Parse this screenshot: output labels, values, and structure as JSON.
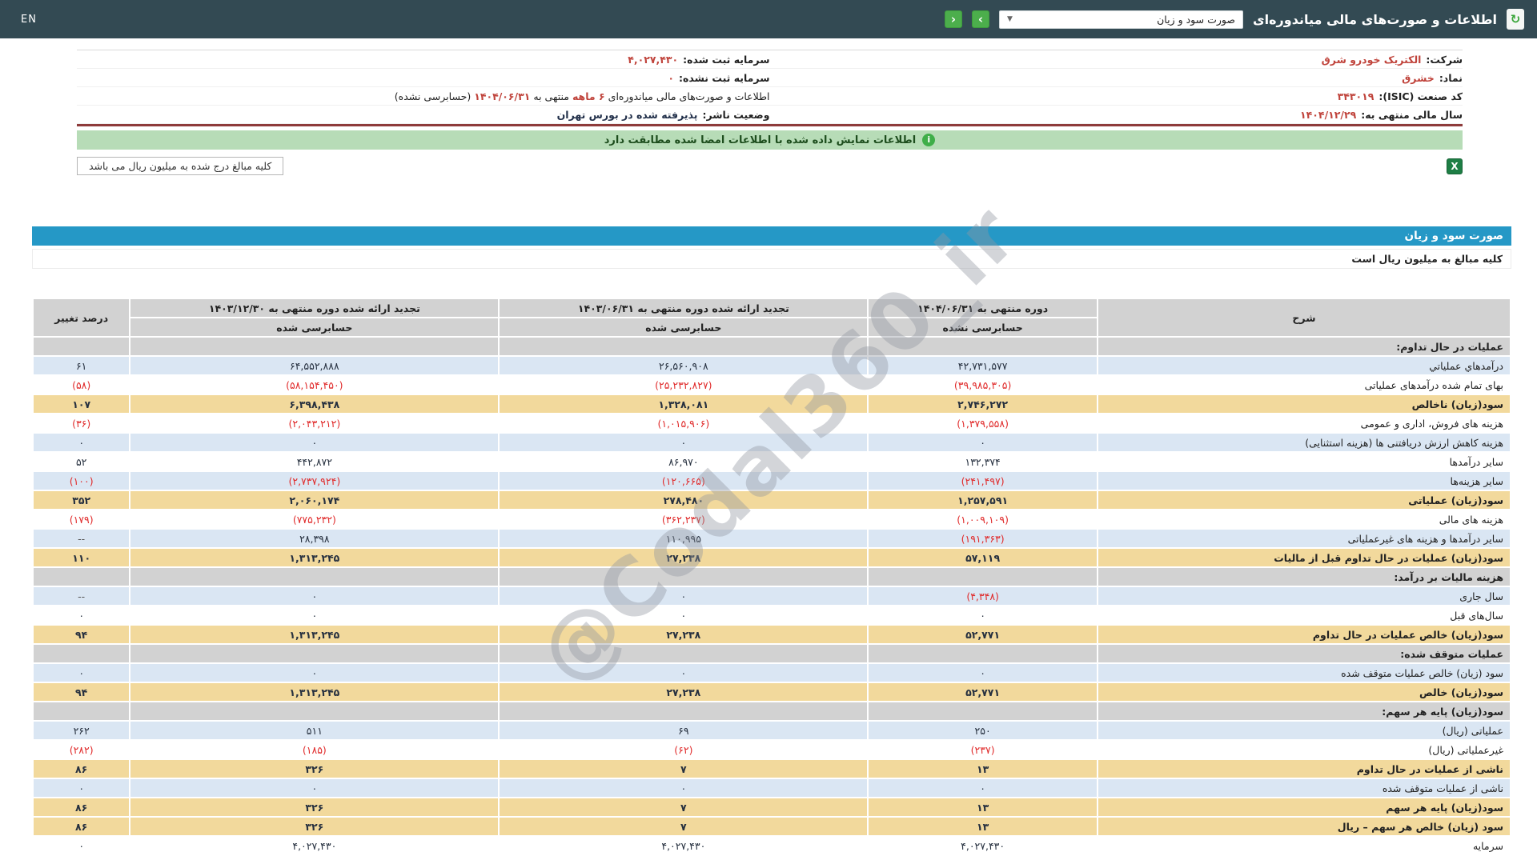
{
  "topbar": {
    "title": "اطلاعات و صورت‌های مالی میاندوره‌ای",
    "report_select_value": "صورت سود و زیان",
    "caret": "▼",
    "next_button": "›",
    "prev_button": "‹",
    "en_label": "EN"
  },
  "company": {
    "name_label": "شرکت:",
    "name": "الکتریک خودرو شرق",
    "symbol_label": "نماد:",
    "symbol": "خشرق",
    "isic_label": "کد صنعت (ISIC):",
    "isic": "۳۴۳۰۱۹",
    "fiscal_label": "سال مالی منتهی به:",
    "fiscal": "۱۴۰۴/۱۲/۲۹",
    "cap_reg_label": "سرمایه ثبت شده:",
    "cap_reg": "۴,۰۲۷,۴۳۰",
    "cap_unreg_label": "سرمایه ثبت نشده:",
    "cap_unreg": "۰",
    "period_prefix": "اطلاعات و صورت‌های مالی میاندوره‌ای",
    "period_months": "۶ ماهه",
    "period_mid": "منتهی به",
    "period_date": "۱۴۰۴/۰۶/۳۱",
    "period_suffix": "(حسابرسی نشده)",
    "status_label": "وضعیت ناشر:",
    "status": "پذیرفته شده در بورس تهران"
  },
  "notice": {
    "text": "اطلاعات نمایش داده شده با اطلاعات امضا شده مطابقت دارد",
    "icon": "i"
  },
  "unit_note": "کلیه مبالغ درج شده به میلیون ریال می باشد",
  "excel_icon_label": "X",
  "watermark": "@Codal360_ir",
  "statement": {
    "title": "صورت سود و زیان",
    "unit_line": "کلیه مبالغ به میلیون ریال است",
    "columns": {
      "desc": "شرح",
      "p1": "دوره منتهی به ۱۴۰۴/۰۶/۳۱",
      "p1_sub": "حسابرسی نشده",
      "p2": "تجدید ارائه شده دوره منتهی به ۱۴۰۳/۰۶/۳۱",
      "p2_sub": "حسابرسی شده",
      "p3": "تجدید ارائه شده دوره منتهی به ۱۴۰۳/۱۲/۳۰",
      "p3_sub": "حسابرسی شده",
      "pct": "درصد تغییر"
    },
    "rows": [
      {
        "type": "section",
        "label": "عملیات در حال تداوم:"
      },
      {
        "type": "data",
        "bg": "blue",
        "label": "درآمدهاي عملياتي",
        "v1": "۴۲,۷۳۱,۵۷۷",
        "v2": "۲۶,۵۶۰,۹۰۸",
        "v3": "۶۴,۵۵۲,۸۸۸",
        "pct": "۶۱"
      },
      {
        "type": "data",
        "bg": "white",
        "label": "بهای تمام شده درآمدهای عملیاتی",
        "v1": "(۳۹,۹۸۵,۳۰۵)",
        "v2": "(۲۵,۲۳۲,۸۲۷)",
        "v3": "(۵۸,۱۵۴,۴۵۰)",
        "pct": "(۵۸)"
      },
      {
        "type": "data",
        "bg": "yellow",
        "label": "سود(زیان) ناخالص",
        "v1": "۲,۷۴۶,۲۷۲",
        "v2": "۱,۳۲۸,۰۸۱",
        "v3": "۶,۳۹۸,۴۳۸",
        "pct": "۱۰۷"
      },
      {
        "type": "data",
        "bg": "white",
        "label": "هزینه های فروش، اداری و عمومی",
        "v1": "(۱,۳۷۹,۵۵۸)",
        "v2": "(۱,۰۱۵,۹۰۶)",
        "v3": "(۲,۰۴۳,۲۱۲)",
        "pct": "(۳۶)"
      },
      {
        "type": "data",
        "bg": "blue",
        "label": "هزینه کاهش ارزش دریافتنی ها (هزینه استثنایی)",
        "v1": "۰",
        "v2": "۰",
        "v3": "۰",
        "pct": "۰"
      },
      {
        "type": "data",
        "bg": "white",
        "label": "سایر درآمدها",
        "v1": "۱۳۲,۳۷۴",
        "v2": "۸۶,۹۷۰",
        "v3": "۴۴۲,۸۷۲",
        "pct": "۵۲"
      },
      {
        "type": "data",
        "bg": "blue",
        "label": "سایر هزینه‌ها",
        "v1": "(۲۴۱,۴۹۷)",
        "v2": "(۱۲۰,۶۶۵)",
        "v3": "(۲,۷۳۷,۹۲۴)",
        "pct": "(۱۰۰)"
      },
      {
        "type": "data",
        "bg": "yellow",
        "label": "سود(زیان) عملیاتی",
        "v1": "۱,۲۵۷,۵۹۱",
        "v2": "۲۷۸,۴۸۰",
        "v3": "۲,۰۶۰,۱۷۴",
        "pct": "۳۵۲"
      },
      {
        "type": "data",
        "bg": "white",
        "label": "هزینه های مالی",
        "v1": "(۱,۰۰۹,۱۰۹)",
        "v2": "(۳۶۲,۲۳۷)",
        "v3": "(۷۷۵,۲۳۲)",
        "pct": "(۱۷۹)"
      },
      {
        "type": "data",
        "bg": "blue",
        "label": "سایر درآمدها و هزینه های غیرعملیاتی",
        "v1": "(۱۹۱,۳۶۳)",
        "v2": "۱۱۰,۹۹۵",
        "v3": "۲۸,۳۹۸",
        "pct": "--"
      },
      {
        "type": "data",
        "bg": "yellow",
        "label": "سود(زیان) عملیات در حال تداوم قبل از مالیات",
        "v1": "۵۷,۱۱۹",
        "v2": "۲۷,۲۳۸",
        "v3": "۱,۳۱۳,۲۴۵",
        "pct": "۱۱۰"
      },
      {
        "type": "section",
        "label": "هزینه مالیات بر درآمد:"
      },
      {
        "type": "data",
        "bg": "blue",
        "label": "سال جاری",
        "v1": "(۴,۳۴۸)",
        "v2": "۰",
        "v3": "۰",
        "pct": "--"
      },
      {
        "type": "data",
        "bg": "white",
        "label": "سال‌های قبل",
        "v1": "۰",
        "v2": "۰",
        "v3": "۰",
        "pct": "۰"
      },
      {
        "type": "data",
        "bg": "yellow",
        "label": "سود(زیان) خالص عملیات در حال تداوم",
        "v1": "۵۲,۷۷۱",
        "v2": "۲۷,۲۳۸",
        "v3": "۱,۳۱۳,۲۴۵",
        "pct": "۹۴"
      },
      {
        "type": "section",
        "label": "عملیات متوقف شده:"
      },
      {
        "type": "data",
        "bg": "blue",
        "label": "سود (زیان) خالص عملیات متوقف شده",
        "v1": "۰",
        "v2": "۰",
        "v3": "۰",
        "pct": "۰"
      },
      {
        "type": "data",
        "bg": "yellow",
        "label": "سود(زیان) خالص",
        "v1": "۵۲,۷۷۱",
        "v2": "۲۷,۲۳۸",
        "v3": "۱,۳۱۳,۲۴۵",
        "pct": "۹۴"
      },
      {
        "type": "section",
        "label": "سود(زیان) پایه هر سهم:"
      },
      {
        "type": "data",
        "bg": "blue",
        "label": "عملیاتی (ریال)",
        "v1": "۲۵۰",
        "v2": "۶۹",
        "v3": "۵۱۱",
        "pct": "۲۶۲"
      },
      {
        "type": "data",
        "bg": "white",
        "label": "غیرعملیاتی (ریال)",
        "v1": "(۲۳۷)",
        "v2": "(۶۲)",
        "v3": "(۱۸۵)",
        "pct": "(۲۸۲)"
      },
      {
        "type": "data",
        "bg": "yellow",
        "label": "ناشی از عملیات در حال تداوم",
        "v1": "۱۳",
        "v2": "۷",
        "v3": "۳۲۶",
        "pct": "۸۶"
      },
      {
        "type": "data",
        "bg": "blue",
        "label": "ناشی از عملیات متوقف شده",
        "v1": "۰",
        "v2": "۰",
        "v3": "۰",
        "pct": "۰"
      },
      {
        "type": "data",
        "bg": "yellow",
        "label": "سود(زیان) پایه هر سهم",
        "v1": "۱۳",
        "v2": "۷",
        "v3": "۳۲۶",
        "pct": "۸۶"
      },
      {
        "type": "data",
        "bg": "yellow",
        "label": "سود (زیان) خالص هر سهم – ریال",
        "v1": "۱۳",
        "v2": "۷",
        "v3": "۳۲۶",
        "pct": "۸۶"
      },
      {
        "type": "data",
        "bg": "white",
        "label": "سرمایه",
        "v1": "۴,۰۲۷,۴۳۰",
        "v2": "۴,۰۲۷,۴۳۰",
        "v3": "۴,۰۲۷,۴۳۰",
        "pct": "۰"
      }
    ]
  }
}
